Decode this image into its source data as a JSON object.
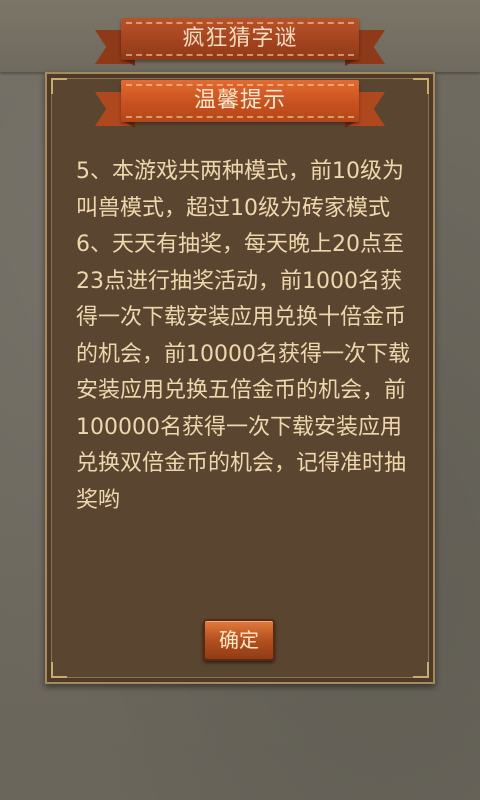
{
  "app": {
    "title": "疯狂猜字谜"
  },
  "dialog": {
    "title": "温馨提示",
    "paragraphs": [
      "5、本游戏共两种模式，前10级为叫兽模式，超过10级为砖家模式",
      "6、天天有抽奖，每天晚上20点至23点进行抽奖活动，前1000名获得一次下载安装应用兑换十倍金币的机会，前10000名获得一次下载安装应用兑换五倍金币的机会，前100000名获得一次下载安装应用兑换双倍金币的机会，记得准时抽奖哟"
    ],
    "confirm_label": "确定"
  },
  "colors": {
    "ribbon": "#c8521f",
    "panel": "#5a4630",
    "text": "#efd7ad",
    "background": "#6e6a5f"
  }
}
